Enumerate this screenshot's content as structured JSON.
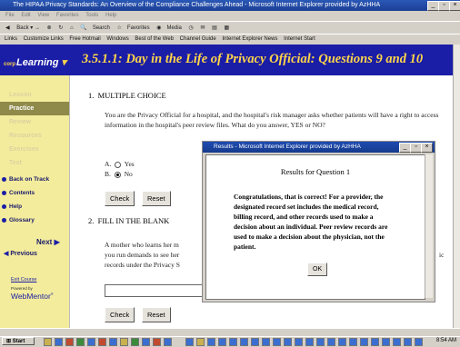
{
  "window": {
    "title": "The HIPAA Privacy Standards: An Overview of the Compliance Challenges Ahead - Microsoft Internet Explorer provided by AzHHA"
  },
  "menubar": [
    "File",
    "Edit",
    "View",
    "Favorites",
    "Tools",
    "Help"
  ],
  "toolbar": [
    "Back",
    "Search",
    "Favorites",
    "Media"
  ],
  "links": {
    "label": "Links",
    "items": [
      "Customize Links",
      "Free Hotmail",
      "Windows",
      "Best of the Web",
      "Channel Guide",
      "Internet Explorer News",
      "Internet Start"
    ]
  },
  "logo": "Learning",
  "headline": "3.5.1.1: Day in the Life of Privacy Official: Questions 9 and 10",
  "nav": {
    "lesson": "Lesson",
    "practice": "Practice",
    "review": "Review",
    "resources": "Resources",
    "exercises": "Exercises",
    "test": "Test",
    "back_on_track": "Back on Track",
    "contents": "Contents",
    "help": "Help",
    "glossary": "Glossary",
    "next": "Next",
    "previous": "Previous",
    "exit_course": "Exit Course",
    "powered_by": "Powered by",
    "webmentor": "WebMentor"
  },
  "q1": {
    "number": "1.",
    "heading": "MULTIPLE CHOICE",
    "text": "You are the Privacy Official for a hospital, and the hospital's risk manager asks whether patients will have a right to access information in the hospital's peer review files. What do you answer, YES or NO?",
    "option_a_letter": "A.",
    "option_a": "Yes",
    "option_b_letter": "B.",
    "option_b": "No",
    "check": "Check",
    "reset": "Reset"
  },
  "q2": {
    "number": "2.",
    "heading": "FILL IN THE BLANK",
    "line1": "A mother who learns her m",
    "line2": "you run demands to see her",
    "line3": "records under the Privacy S",
    "tail": "ic",
    "check": "Check",
    "reset": "Reset"
  },
  "dialog": {
    "title": "Results - Microsoft Internet Explorer provided by AzHHA",
    "heading": "Results for Question 1",
    "lines": [
      "Congratulations, that is correct! For a provider, the",
      "designated record set includes the medical record,",
      "billing record, and other records used to make a",
      "decision about an individual. Peer review records are",
      "used to make a decision about the physician, not the",
      "patient."
    ],
    "ok": "OK"
  },
  "taskbar": {
    "start": "Start",
    "clock": "8:54 AM"
  }
}
